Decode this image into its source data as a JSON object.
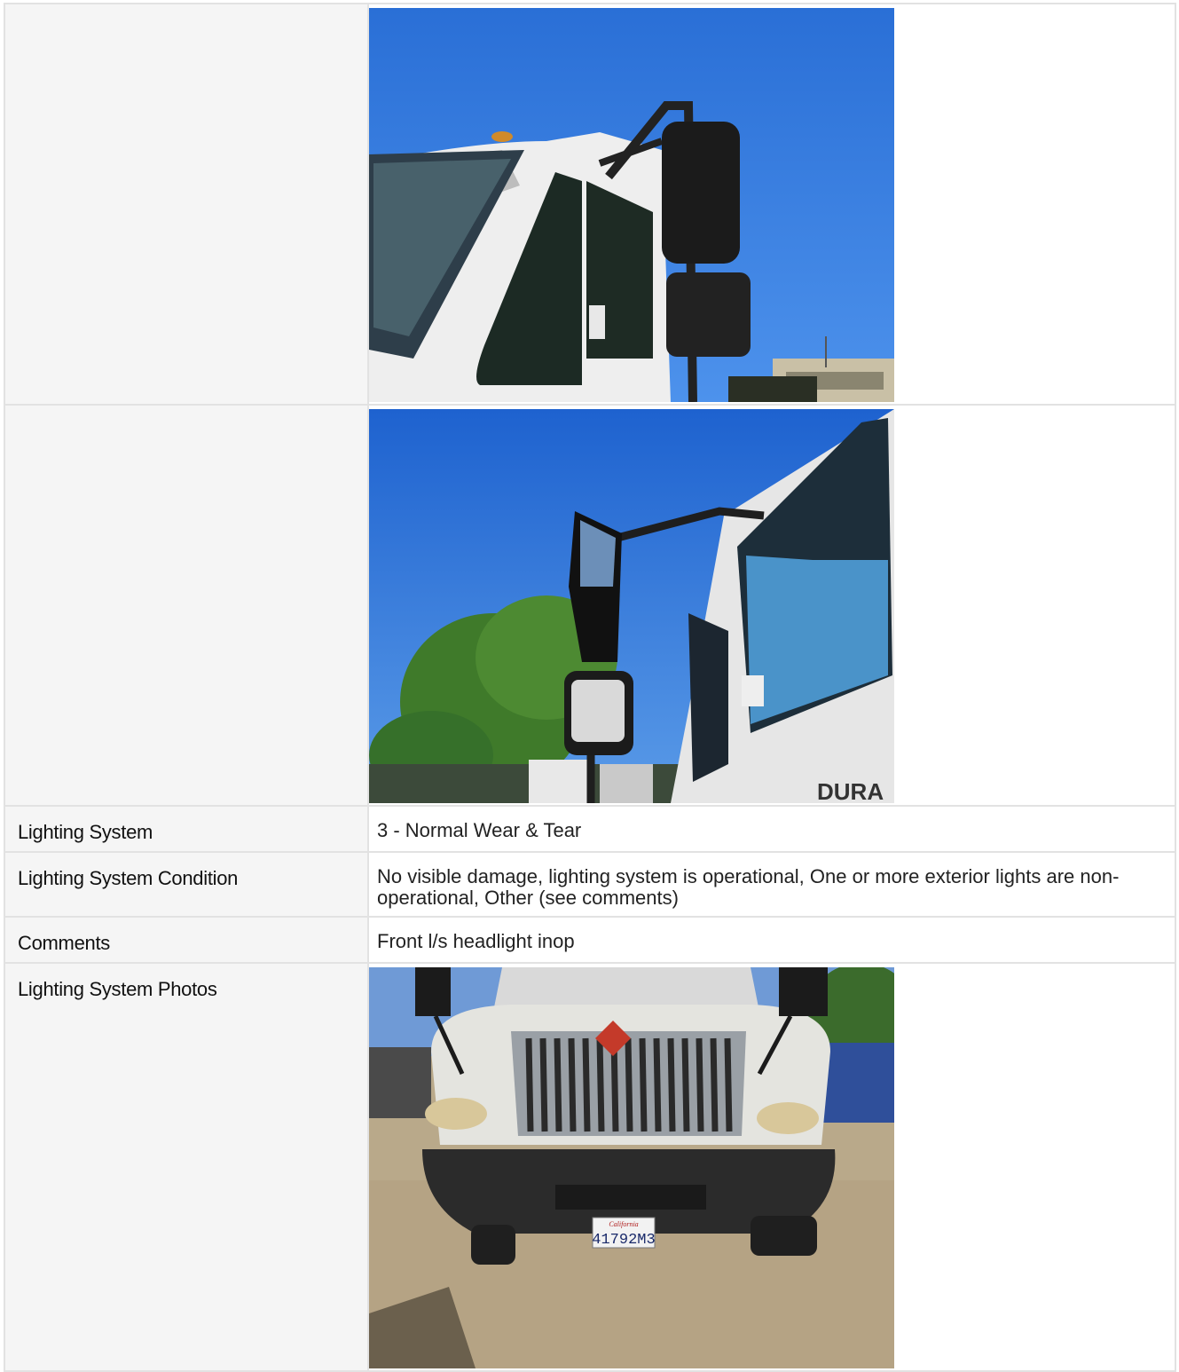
{
  "rows": [
    {
      "label": "",
      "type": "photo",
      "photo_name": "mirror-photo-1"
    },
    {
      "label": "",
      "type": "photo",
      "photo_name": "mirror-photo-2"
    },
    {
      "label": "Lighting System",
      "type": "text",
      "value": "3 - Normal Wear & Tear"
    },
    {
      "label": "Lighting System Condition",
      "type": "text",
      "value": "No visible damage, lighting system is operational, One or more exterior lights are non-operational, Other (see comments)"
    },
    {
      "label": "Comments",
      "type": "text",
      "value": "Front l/s headlight inop"
    },
    {
      "label": "Lighting System Photos",
      "type": "photo",
      "photo_name": "truck-front-photo"
    }
  ],
  "license_plate": {
    "state": "California",
    "number": "41792M3"
  },
  "colors": {
    "label_bg": "#f5f5f5",
    "border": "#e2e2e2",
    "sky": "#2f74d8"
  }
}
